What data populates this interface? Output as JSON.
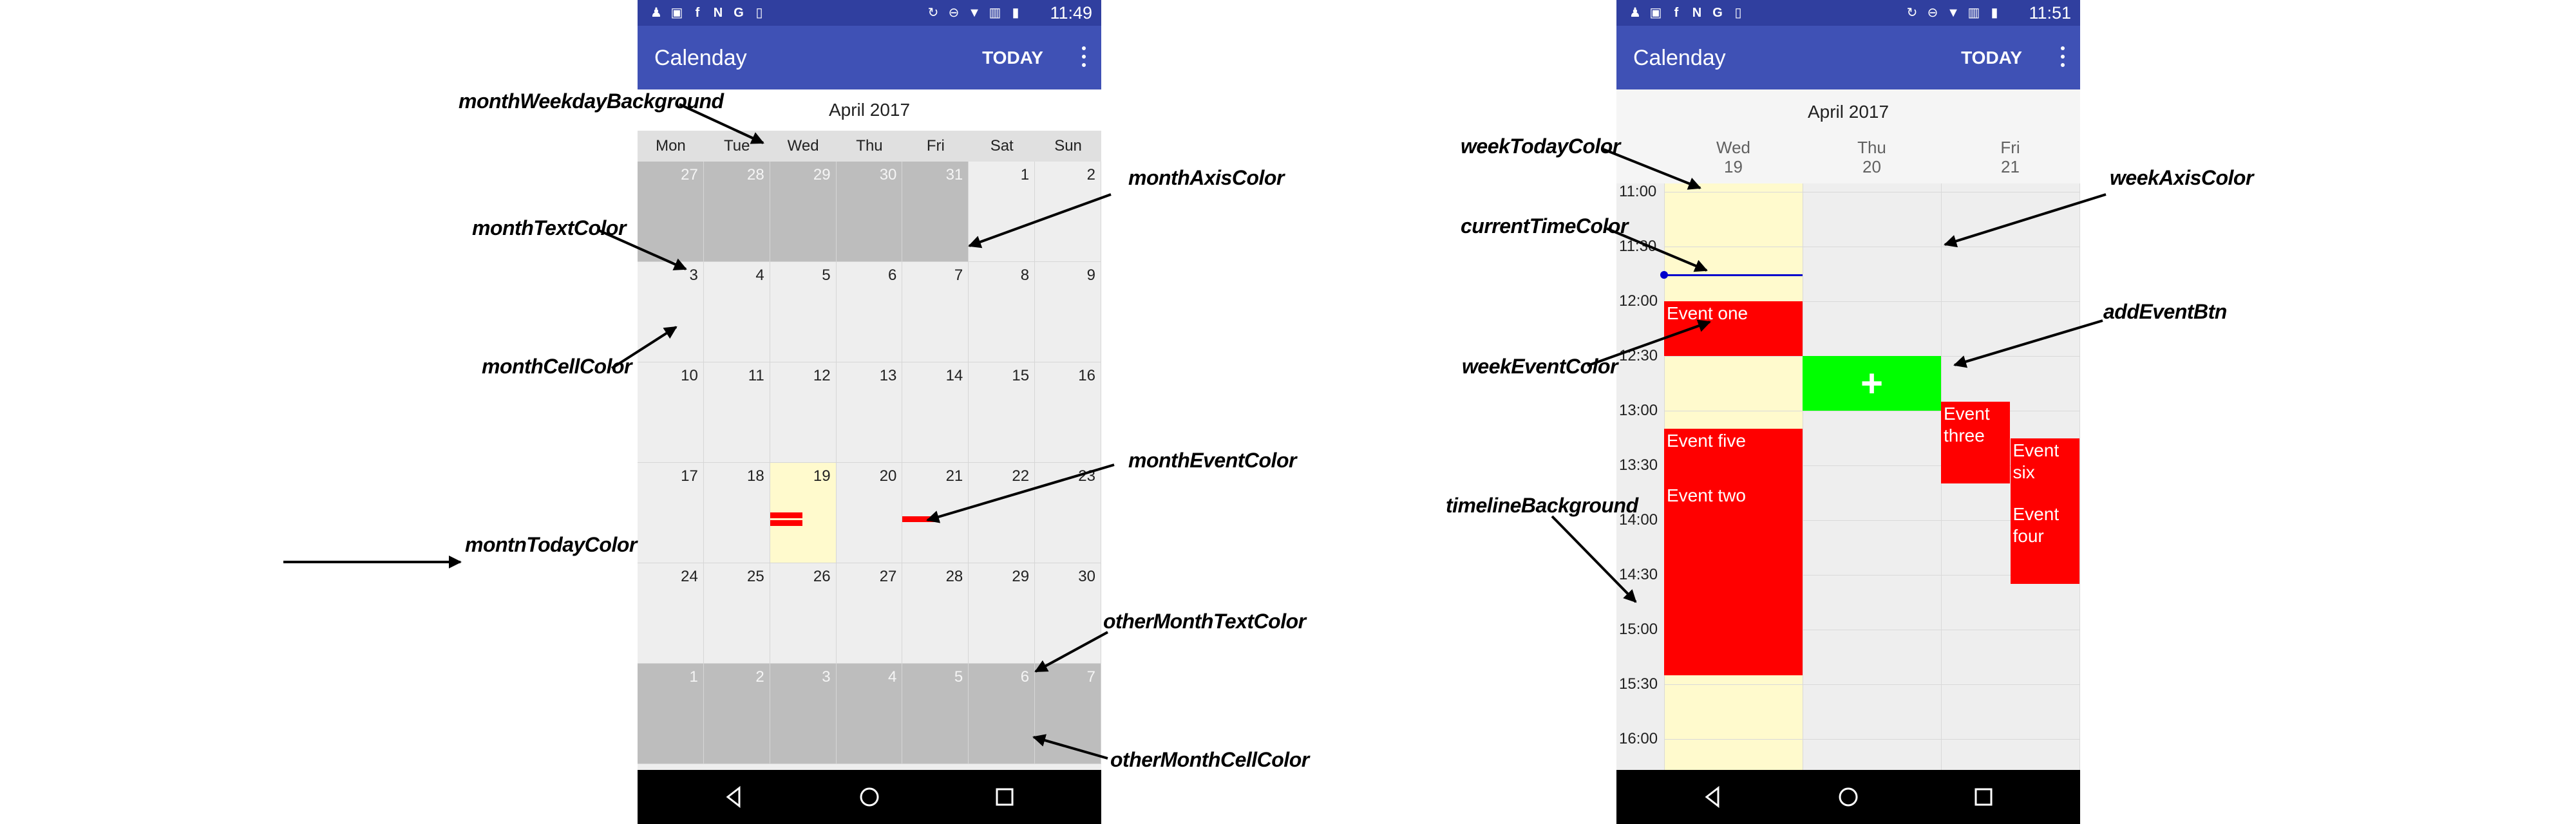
{
  "colors": {
    "status_bar": "#303f9f",
    "app_bar": "#3f51b5",
    "month_cell": "#eeeeee",
    "other_month_cell": "#bdbdbd",
    "today_cell": "#fffacd",
    "event": "#ff0000",
    "add_event": "#00ff00",
    "current_time_line": "#0000cc"
  },
  "left_screen": {
    "status_bar": {
      "icons": [
        "contact-icon",
        "image-icon",
        "facebook-icon",
        "n-icon",
        "google-icon",
        "sim-icon",
        "sync-icon",
        "dnd-icon",
        "wifi-icon",
        "vibrate-icon",
        "battery-icon"
      ],
      "time": "11:49"
    },
    "app_bar": {
      "title": "Calenday",
      "today_label": "TODAY"
    },
    "month_title": "April 2017",
    "weekdays": [
      "Mon",
      "Tue",
      "Wed",
      "Thu",
      "Fri",
      "Sat",
      "Sun"
    ],
    "weeks": [
      [
        {
          "n": "27",
          "other": true
        },
        {
          "n": "28",
          "other": true
        },
        {
          "n": "29",
          "other": true
        },
        {
          "n": "30",
          "other": true
        },
        {
          "n": "31",
          "other": true
        },
        {
          "n": "1"
        },
        {
          "n": "2"
        }
      ],
      [
        {
          "n": "3"
        },
        {
          "n": "4"
        },
        {
          "n": "5"
        },
        {
          "n": "6"
        },
        {
          "n": "7"
        },
        {
          "n": "8"
        },
        {
          "n": "9"
        }
      ],
      [
        {
          "n": "10"
        },
        {
          "n": "11"
        },
        {
          "n": "12"
        },
        {
          "n": "13"
        },
        {
          "n": "14"
        },
        {
          "n": "15"
        },
        {
          "n": "16"
        }
      ],
      [
        {
          "n": "17"
        },
        {
          "n": "18"
        },
        {
          "n": "19",
          "today": true,
          "events": 2
        },
        {
          "n": "20"
        },
        {
          "n": "21",
          "events": 1
        },
        {
          "n": "22"
        },
        {
          "n": "23"
        }
      ],
      [
        {
          "n": "24"
        },
        {
          "n": "25"
        },
        {
          "n": "26"
        },
        {
          "n": "27"
        },
        {
          "n": "28"
        },
        {
          "n": "29"
        },
        {
          "n": "30"
        }
      ],
      [
        {
          "n": "1",
          "other": true
        },
        {
          "n": "2",
          "other": true
        },
        {
          "n": "3",
          "other": true
        },
        {
          "n": "4",
          "other": true
        },
        {
          "n": "5",
          "other": true
        },
        {
          "n": "6",
          "other": true
        },
        {
          "n": "7",
          "other": true
        }
      ]
    ],
    "annotations": {
      "month_weekday_background": "monthWeekdayBackground",
      "month_axis_color": "monthAxisColor",
      "month_text_color": "monthTextColor",
      "month_cell_color": "monthCellColor",
      "month_event_color": "monthEventColor",
      "montn_today_color": "montnTodayColor",
      "other_month_text_color": "otherMonthTextColor",
      "other_month_cell_color": "otherMonthCellColor"
    }
  },
  "right_screen": {
    "status_bar": {
      "icons": [
        "contact-icon",
        "image-icon",
        "facebook-icon",
        "n-icon",
        "google-icon",
        "sim-icon",
        "sync-icon",
        "dnd-icon",
        "wifi-icon",
        "vibrate-icon",
        "battery-icon"
      ],
      "time": "11:51"
    },
    "app_bar": {
      "title": "Calenday",
      "today_label": "TODAY"
    },
    "month_title": "April 2017",
    "days": [
      {
        "name": "Wed",
        "num": "19"
      },
      {
        "name": "Thu",
        "num": "20"
      },
      {
        "name": "Fri",
        "num": "21"
      }
    ],
    "times": [
      "11:00",
      "11:30",
      "12:00",
      "12:30",
      "13:00",
      "13:30",
      "14:00",
      "14:30",
      "15:00",
      "15:30",
      "16:00"
    ],
    "events": [
      {
        "title": "Event one",
        "day": "Wed",
        "start": "12:00",
        "end": "12:30"
      },
      {
        "title": "Event five",
        "day": "Wed",
        "start": "13:10",
        "end": "13:40"
      },
      {
        "title": "Event two",
        "day": "Wed",
        "start": "13:40",
        "end": "15:25"
      },
      {
        "title": "Event three",
        "day": "Fri",
        "start": "12:55",
        "end": "13:40"
      },
      {
        "title": "Event six",
        "day": "Fri",
        "start": "13:15",
        "end": "14:25"
      },
      {
        "title": "Event four",
        "day": "Fri",
        "start": "13:50",
        "end": "14:35"
      }
    ],
    "add_event": {
      "day": "Thu",
      "start": "12:30",
      "end": "13:00",
      "symbol": "+"
    },
    "current_time": "11:45",
    "annotations": {
      "week_today_color": "weekTodayColor",
      "current_time_color": "currentTimeColor",
      "week_event_color": "weekEventColor",
      "timeline_background": "timelineBackground",
      "week_axis_color": "weekAxisColor",
      "add_event_btn": "addEventBtn"
    }
  }
}
